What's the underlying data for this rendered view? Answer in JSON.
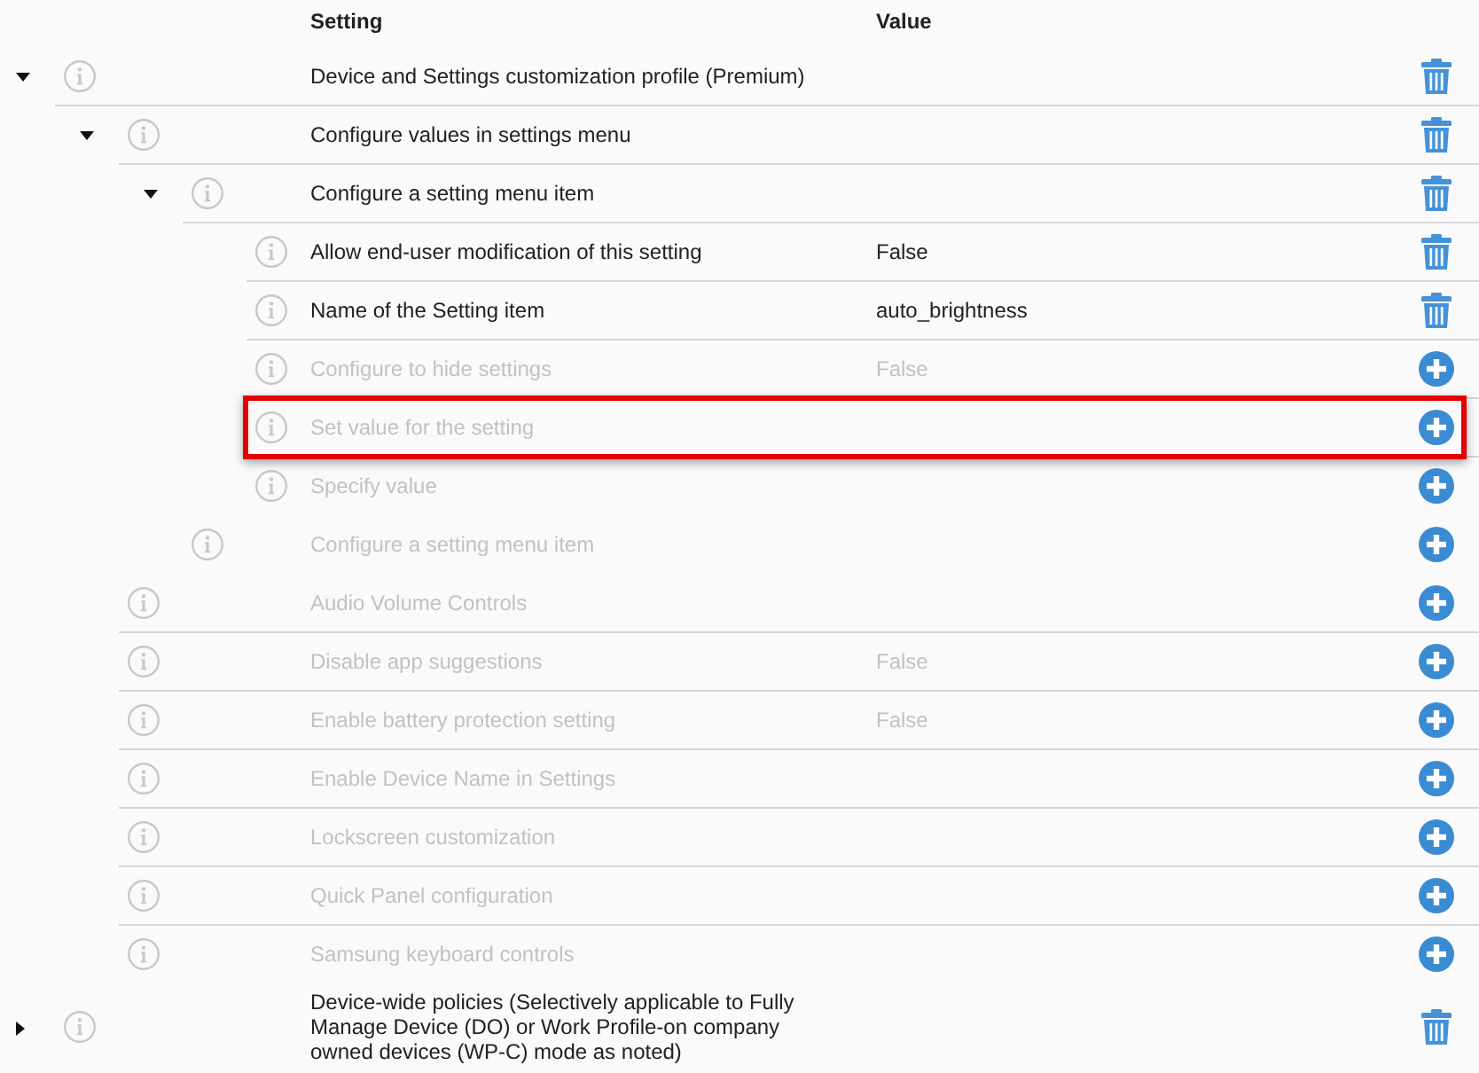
{
  "table": {
    "columns": [
      "Setting",
      "Value"
    ],
    "rows": [
      {
        "label": "Device and Settings customization profile (Premium)",
        "configured": true,
        "expanded": true,
        "children": [
          {
            "label": "Configure values in settings menu",
            "configured": true,
            "expanded": true,
            "children": [
              {
                "label": "Configure a setting menu item",
                "configured": true,
                "expanded": true,
                "children": [
                  {
                    "label": "Allow end-user modification of this setting",
                    "value": "False",
                    "configured": true
                  },
                  {
                    "label": "Name of the Setting item",
                    "value": "auto_brightness",
                    "configured": true
                  },
                  {
                    "label": "Configure to hide settings",
                    "value": "False",
                    "configured": false
                  },
                  {
                    "label": "Set value for the setting",
                    "configured": false,
                    "highlighted": true
                  },
                  {
                    "label": "Specify value",
                    "configured": false
                  }
                ]
              },
              {
                "label": "Configure a setting menu item",
                "configured": false
              }
            ]
          },
          {
            "label": "Audio Volume Controls",
            "configured": false
          },
          {
            "label": "Disable app suggestions",
            "value": "False",
            "configured": false
          },
          {
            "label": "Enable battery protection setting",
            "value": "False",
            "configured": false
          },
          {
            "label": "Enable Device Name in Settings",
            "configured": false
          },
          {
            "label": "Lockscreen customization",
            "configured": false
          },
          {
            "label": "Quick Panel configuration",
            "configured": false
          },
          {
            "label": "Samsung keyboard controls",
            "configured": false
          }
        ]
      },
      {
        "label": "Device-wide policies (Selectively applicable to Fully Manage Device (DO) or Work Profile-on company owned devices (WP-C) mode as noted)",
        "configured": true,
        "expanded": false
      }
    ]
  }
}
